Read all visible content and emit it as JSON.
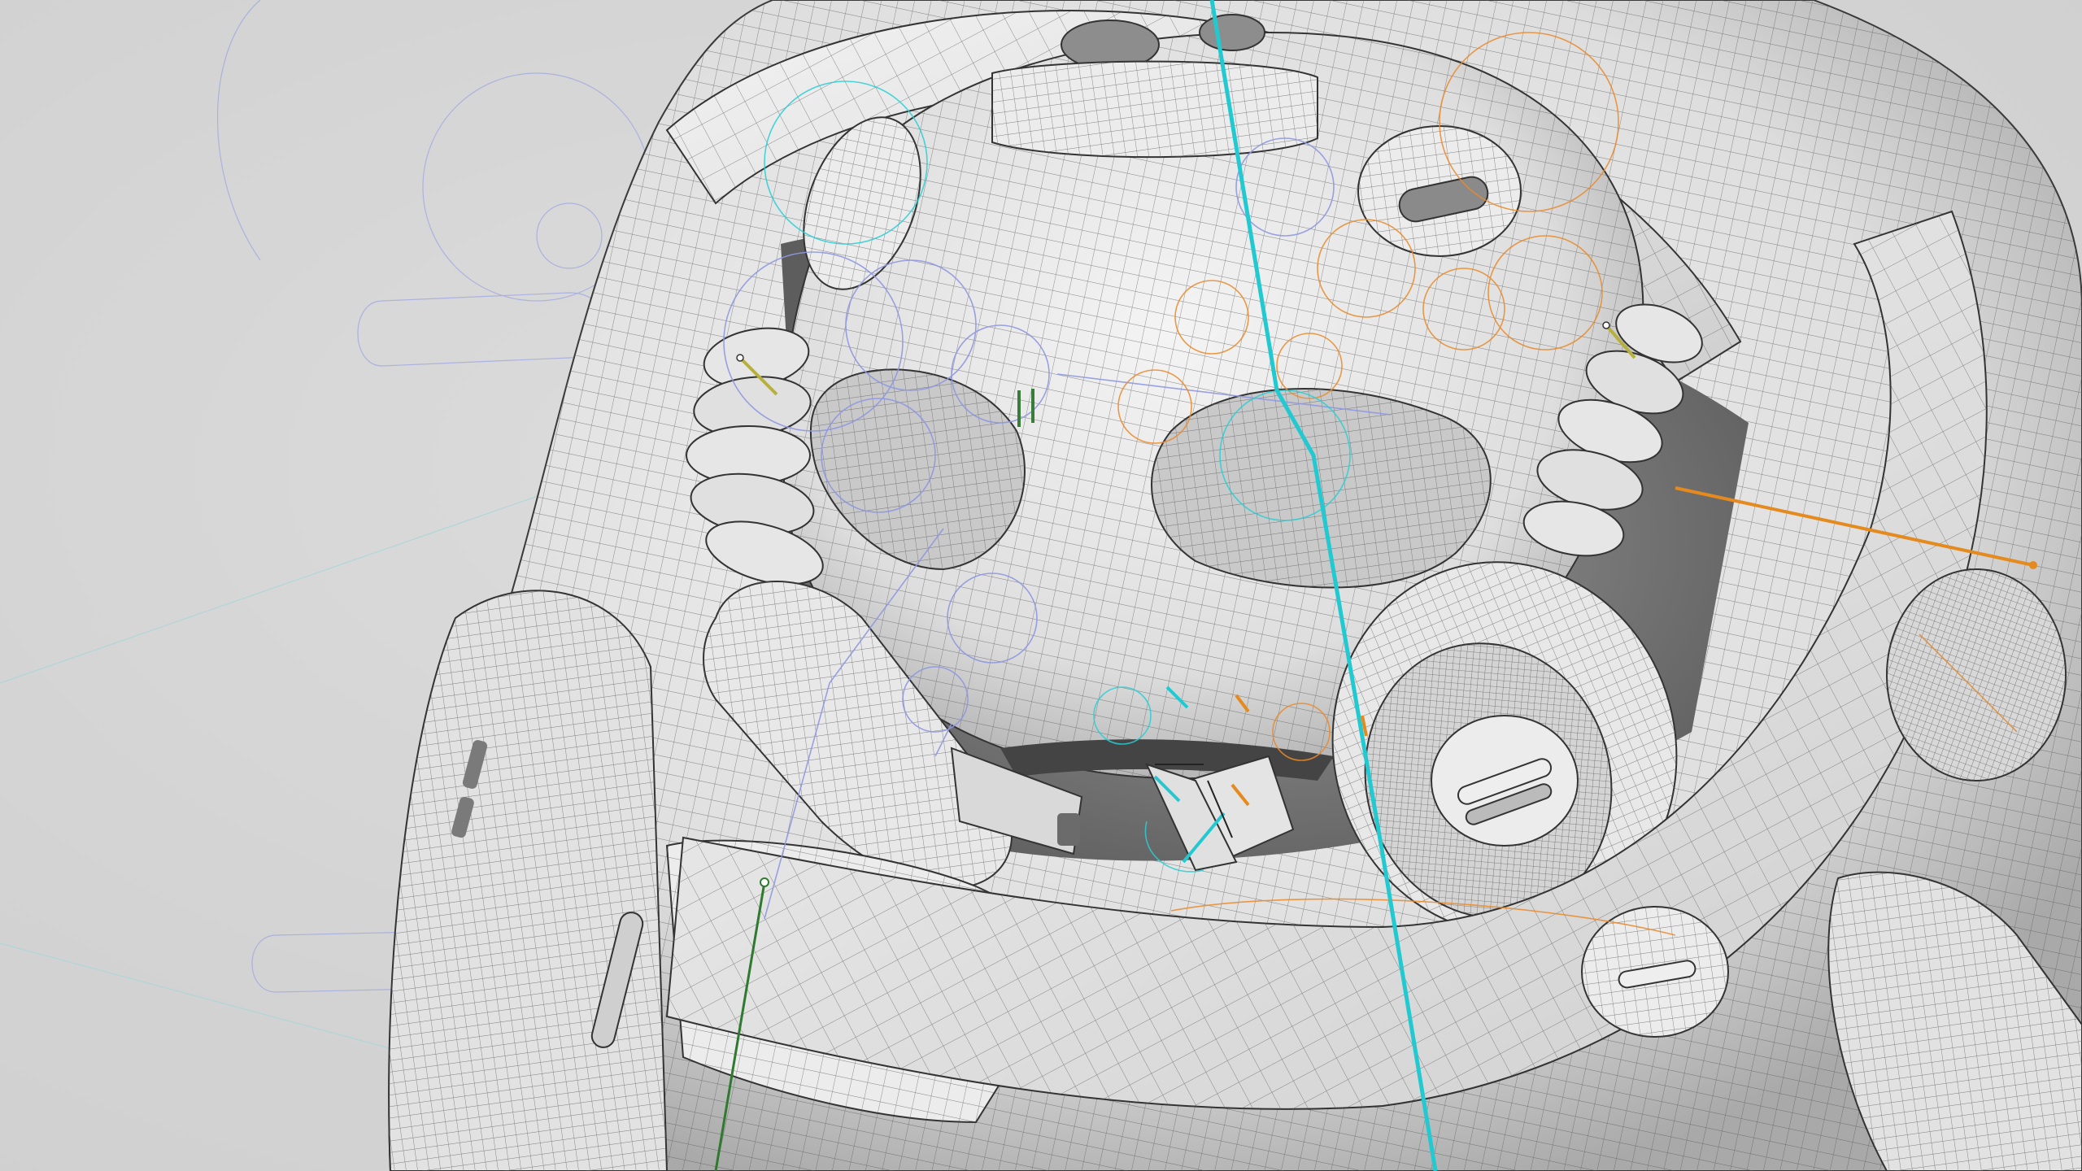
{
  "scene": {
    "description_free": true,
    "colors": {
      "background": "#d5d5d5",
      "surface": "#ededed",
      "surface_shadow": "#bdbdbd",
      "wire": "#555555",
      "curve_blue": "#8f98e0",
      "curve_cyan": "#28cfd6",
      "curve_orange": "#e98a2a",
      "curve_green": "#3a7d3a"
    },
    "icons": [
      "wireframe-mesh",
      "construction-curves"
    ]
  }
}
